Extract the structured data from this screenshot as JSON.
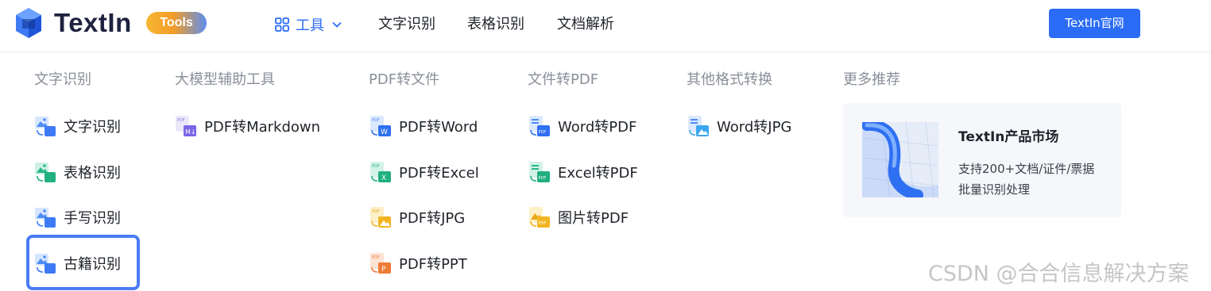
{
  "header": {
    "brand": "TextIn",
    "badge": "Tools",
    "tools_menu": "工具",
    "nav": [
      "文字识别",
      "表格识别",
      "文档解析"
    ],
    "site_button": "TextIn官网"
  },
  "menu": {
    "columns": [
      {
        "title": "文字识别",
        "items": [
          "文字识别",
          "表格识别",
          "手写识别",
          "古籍识别"
        ]
      },
      {
        "title": "大模型辅助工具",
        "items": [
          "PDF转Markdown"
        ]
      },
      {
        "title": "PDF转文件",
        "items": [
          "PDF转Word",
          "PDF转Excel",
          "PDF转JPG",
          "PDF转PPT"
        ]
      },
      {
        "title": "文件转PDF",
        "items": [
          "Word转PDF",
          "Excel转PDF",
          "图片转PDF"
        ]
      },
      {
        "title": "其他格式转换",
        "items": [
          "Word转JPG"
        ]
      },
      {
        "title": "更多推荐"
      }
    ],
    "highlighted_item": "古籍识别"
  },
  "promo": {
    "title": "TextIn产品市场",
    "desc_line1": "支持200+文档/证件/票据",
    "desc_line2": "批量识别处理"
  },
  "watermark": "CSDN @合合信息解决方案",
  "colors": {
    "accent": "#2b6cf6",
    "highlight_border": "#4a7cf4",
    "muted_title": "#8a8f99"
  }
}
